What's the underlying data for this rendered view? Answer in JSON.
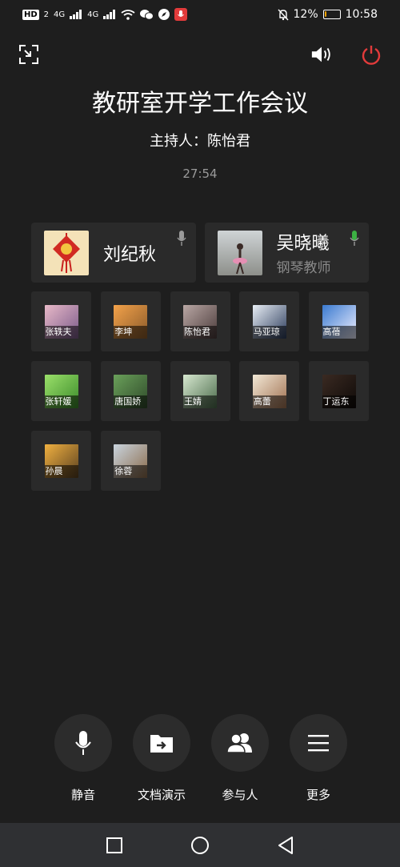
{
  "status_bar": {
    "hd_badge": "HD",
    "hd_sub": "2",
    "network_1": "4G",
    "network_2": "4G",
    "battery_percent": "12%",
    "battery_level": 0.12,
    "time": "10:58"
  },
  "meeting": {
    "title": "教研室开学工作会议",
    "host": "主持人：陈怡君",
    "elapsed": "27:54"
  },
  "featured": [
    {
      "name": "刘纪秋",
      "role": "",
      "mic_color": "#9a9a9a",
      "avatar_icon": "red-chinese-knot"
    },
    {
      "name": "吴晓曦",
      "role": "钢琴教师",
      "mic_color": "#3cb043",
      "avatar_icon": "dancer-on-beach"
    }
  ],
  "participants": [
    {
      "name": "张轶夫",
      "c1": "#e8b9c8",
      "c2": "#7a5a8a"
    },
    {
      "name": "李坤",
      "c1": "#f3a24a",
      "c2": "#8a5a2a"
    },
    {
      "name": "陈怡君",
      "c1": "#b9a7a4",
      "c2": "#4a3a3a"
    },
    {
      "name": "马亚琼",
      "c1": "#e8eef5",
      "c2": "#2a3a5a"
    },
    {
      "name": "高蓓",
      "c1": "#3a7ad0",
      "c2": "#f0f0ff"
    },
    {
      "name": "张轩媛",
      "c1": "#9be06a",
      "c2": "#3a8a2a"
    },
    {
      "name": "唐国娇",
      "c1": "#6aa05a",
      "c2": "#2f4a2a"
    },
    {
      "name": "王婧",
      "c1": "#d7e8d0",
      "c2": "#4a6a4a"
    },
    {
      "name": "高蕾",
      "c1": "#f2e8d6",
      "c2": "#a07050"
    },
    {
      "name": "丁运东",
      "c1": "#3a2a22",
      "c2": "#0f0a08"
    },
    {
      "name": "孙晨",
      "c1": "#f0b040",
      "c2": "#5a4020"
    },
    {
      "name": "徐蓉",
      "c1": "#c9d4de",
      "c2": "#8a6a4a"
    }
  ],
  "controls": [
    {
      "label": "静音",
      "icon": "mic-icon"
    },
    {
      "label": "文档演示",
      "icon": "folder-share-icon"
    },
    {
      "label": "参与人",
      "icon": "people-icon"
    },
    {
      "label": "更多",
      "icon": "menu-icon"
    }
  ],
  "colors": {
    "background": "#1e1e1e",
    "card": "#2a2a2a",
    "power": "#e23b3b",
    "mic_active": "#3cb043",
    "navbar": "#2f3033"
  }
}
